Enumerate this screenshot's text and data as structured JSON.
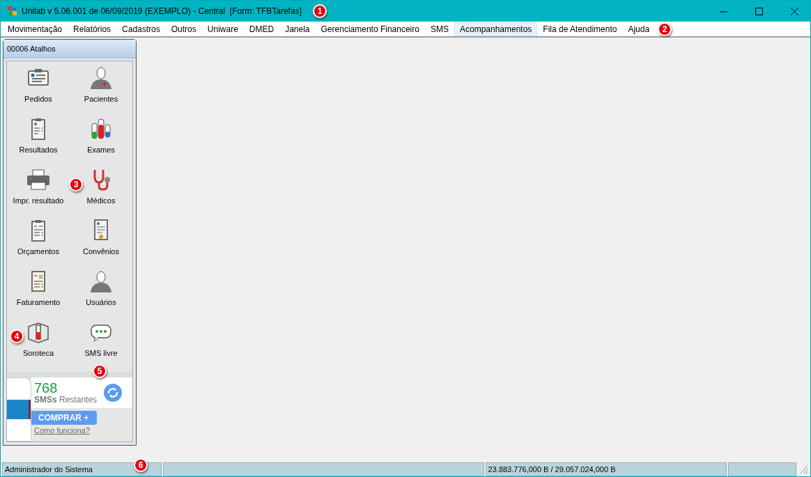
{
  "window": {
    "title": "Unilab v 5.06.001 de 06/09/2019 (EXEMPLO) - Central  [Form: TFBTarefas]"
  },
  "menu": [
    {
      "label": "Movimentação",
      "selected": false
    },
    {
      "label": "Relatórios",
      "selected": false
    },
    {
      "label": "Cadastros",
      "selected": false
    },
    {
      "label": "Outros",
      "selected": false
    },
    {
      "label": "Uniware",
      "selected": false
    },
    {
      "label": "DMED",
      "selected": false
    },
    {
      "label": "Janela",
      "selected": false
    },
    {
      "label": "Gerenciamento Financeiro",
      "selected": false
    },
    {
      "label": "SMS",
      "selected": false
    },
    {
      "label": "Acompanhamentos",
      "selected": true
    },
    {
      "label": "Fila de Atendimento",
      "selected": false
    },
    {
      "label": "Ajuda",
      "selected": false
    }
  ],
  "shortcuts": {
    "title": "00006 Atalhos",
    "items": [
      {
        "label": "Pedidos"
      },
      {
        "label": "Pacientes"
      },
      {
        "label": "Resultados"
      },
      {
        "label": "Exames"
      },
      {
        "label": "Impr. resultado"
      },
      {
        "label": "Médicos"
      },
      {
        "label": "Orçamentos"
      },
      {
        "label": "Convênios"
      },
      {
        "label": "Faturamento"
      },
      {
        "label": "Usuários"
      },
      {
        "label": "Soroteca"
      },
      {
        "label": "SMS livre"
      }
    ]
  },
  "sms_widget": {
    "count": "768",
    "caption_bold": "SMSs",
    "caption": "Restantes",
    "buy_button": "COMPRAR +",
    "help_link": "Como funciona?"
  },
  "status_bar": {
    "user": "Administrador do Sistema",
    "memory": "23.883.776,000 B / 29.057.024,000 B"
  },
  "callouts": [
    "1",
    "2",
    "3",
    "4",
    "5",
    "6"
  ]
}
